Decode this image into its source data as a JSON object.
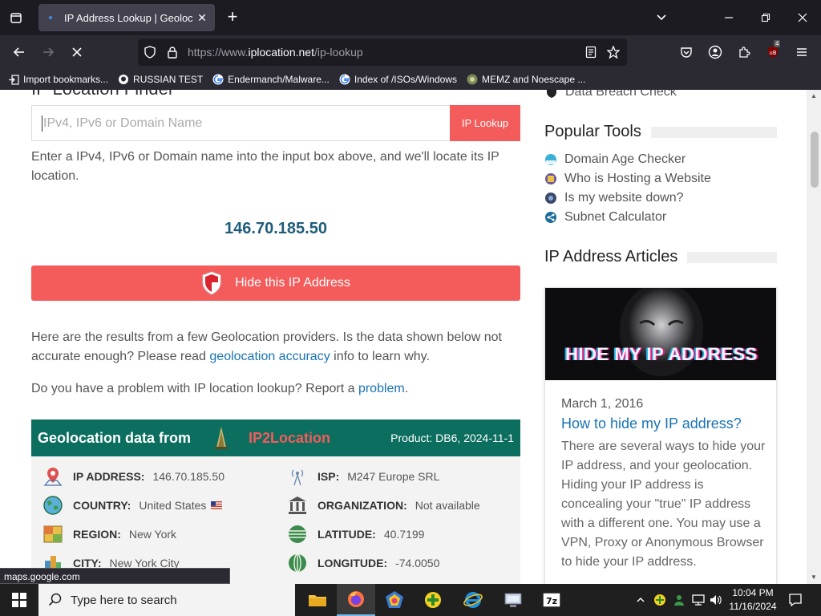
{
  "browser": {
    "tab_title": "IP Address Lookup | Geolocatio",
    "url_prefix": "https://www.",
    "url_host": "iplocation.net",
    "url_path": "/ip-lookup",
    "badge_count": "4",
    "bookmarks": [
      {
        "label": "Import bookmarks...",
        "icon": "import-icon"
      },
      {
        "label": "RUSSIAN TEST",
        "icon": "github-icon"
      },
      {
        "label": "Endermanch/Malware...",
        "icon": "google-icon"
      },
      {
        "label": "Index of /ISOs/Windows",
        "icon": "google-icon"
      },
      {
        "label": "MEMZ and Noescape ...",
        "icon": "site-icon"
      }
    ]
  },
  "page": {
    "heading_partial": "IP Location Finder",
    "search_placeholder": "IPv4, IPv6 or Domain Name",
    "lookup_button": "IP Lookup",
    "intro": "Enter a IPv4, IPv6 or Domain name into the input box above, and we'll locate its IP location.",
    "ip_address": "146.70.185.50",
    "hide_button": "Hide this IP Address",
    "results_text_1": "Here are the results from a few Geolocation providers. Is the data shown below not accurate enough? Please read ",
    "results_link": "geolocation accuracy",
    "results_text_2": " info to learn why.",
    "problem_text": "Do you have a problem with IP location lookup? Report a ",
    "problem_link": "problem",
    "problem_end": ".",
    "geo": {
      "title": "Geolocation data from",
      "provider": "IP2Location",
      "product": "Product: DB6, 2024-11-1",
      "fields": [
        {
          "label": "IP ADDRESS:",
          "value": "146.70.185.50",
          "icon": "location-pin-icon"
        },
        {
          "label": "ISP:",
          "value": "M247 Europe SRL",
          "icon": "antenna-icon"
        },
        {
          "label": "COUNTRY:",
          "value": "United States",
          "icon": "globe-icon"
        },
        {
          "label": "ORGANIZATION:",
          "value": "Not available",
          "icon": "building-icon"
        },
        {
          "label": "REGION:",
          "value": "New York",
          "icon": "map-icon"
        },
        {
          "label": "LATITUDE:",
          "value": "40.7199",
          "icon": "latitude-icon"
        },
        {
          "label": "CITY:",
          "value": "New York City",
          "icon": "city-icon"
        },
        {
          "label": "LONGITUDE:",
          "value": "-74.0050",
          "icon": "longitude-icon"
        }
      ]
    }
  },
  "sidebar": {
    "top_link": "Data Breach Check",
    "popular_title": "Popular Tools",
    "tools": [
      {
        "label": "Domain Age Checker",
        "icon": "domain-age-icon"
      },
      {
        "label": "Who is Hosting a Website",
        "icon": "hosting-icon"
      },
      {
        "label": "Is my website down?",
        "icon": "website-down-icon"
      },
      {
        "label": "Subnet Calculator",
        "icon": "subnet-icon"
      }
    ],
    "articles_title": "IP Address Articles",
    "article": {
      "image_text": "HIDE MY IP ADDRESS",
      "date": "March 1, 2016",
      "title": "How to hide my IP address?",
      "body": "There are several ways to hide your IP address, and your geolocation. Hiding your IP address is concealing your \"true\" IP address with a different one. You may use a VPN, Proxy or Anonymous Browser to hide your IP address."
    }
  },
  "status_url": "maps.google.com",
  "taskbar": {
    "search_placeholder": "Type here to search",
    "time": "10:04 PM",
    "date": "11/16/2024"
  }
}
